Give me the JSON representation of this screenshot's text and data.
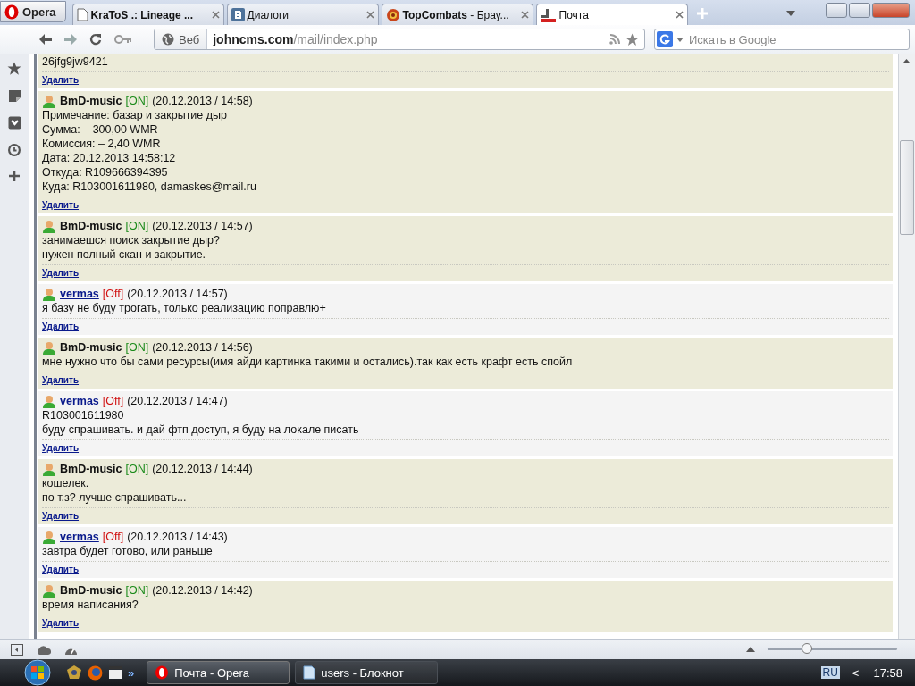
{
  "browser": {
    "menu_button": "Opera",
    "tabs": [
      {
        "label": "KraToS .: Lineage ...",
        "bold": true,
        "kind": "page",
        "selected": false
      },
      {
        "label": "Диалоги",
        "bold": false,
        "kind": "vk",
        "selected": false
      },
      {
        "label": "**TopCombats** - Брау...",
        "bold": false,
        "kind": "emblem",
        "selected": false
      },
      {
        "label": "Почта",
        "bold": false,
        "kind": "cms",
        "selected": true
      }
    ],
    "address": {
      "scope": "Веб",
      "host": "johncms.com",
      "path": "/mail/index.php"
    },
    "search": {
      "placeholder": "Искать в Google"
    }
  },
  "messages": [
    {
      "partial": true,
      "online": true,
      "lines": [
        "26jfg9jw9421"
      ],
      "delete": "Удалить"
    },
    {
      "partial": false,
      "author": "BmD-music",
      "online": true,
      "status": "[ON]",
      "time": "(20.12.2013 / 14:58)",
      "lines": [
        "Примечание: базар и закрытие дыр",
        "Сумма: – 300,00 WMR",
        "Комиссия: – 2,40 WMR",
        "Дата: 20.12.2013 14:58:12",
        "Откуда: R109666394395",
        "Куда: R103001611980, damaskes@mail.ru"
      ],
      "delete": "Удалить"
    },
    {
      "partial": false,
      "author": "BmD-music",
      "online": true,
      "status": "[ON]",
      "time": "(20.12.2013 / 14:57)",
      "lines": [
        "занимаешся поиск закрытие дыр?",
        "нужен полный скан и закрытие."
      ],
      "delete": "Удалить"
    },
    {
      "partial": false,
      "author": "vermas",
      "online": false,
      "status": "[Off]",
      "time": "(20.12.2013 / 14:57)",
      "lines": [
        "я базу не буду трогать, только реализацию поправлю+"
      ],
      "delete": "Удалить"
    },
    {
      "partial": false,
      "author": "BmD-music",
      "online": true,
      "status": "[ON]",
      "time": "(20.12.2013 / 14:56)",
      "lines": [
        "мне нужно что бы сами ресурсы(имя айди картинка такими и остались).так как есть крафт есть спойл"
      ],
      "delete": "Удалить"
    },
    {
      "partial": false,
      "author": "vermas",
      "online": false,
      "status": "[Off]",
      "time": "(20.12.2013 / 14:47)",
      "lines": [
        "R103001611980",
        "буду спрашивать. и дай фтп доступ, я буду на локале писать"
      ],
      "delete": "Удалить"
    },
    {
      "partial": false,
      "author": "BmD-music",
      "online": true,
      "status": "[ON]",
      "time": "(20.12.2013 / 14:44)",
      "lines": [
        "кошелек.",
        "по т.з? лучше спрашивать..."
      ],
      "delete": "Удалить"
    },
    {
      "partial": false,
      "author": "vermas",
      "online": false,
      "status": "[Off]",
      "time": "(20.12.2013 / 14:43)",
      "lines": [
        "завтра будет готово, или раньше"
      ],
      "delete": "Удалить"
    },
    {
      "partial": false,
      "author": "BmD-music",
      "online": true,
      "status": "[ON]",
      "time": "(20.12.2013 / 14:42)",
      "lines": [
        "время написания?"
      ],
      "delete": "Удалить"
    }
  ],
  "status_bar": {
    "zoom": {
      "level": 0.3
    }
  },
  "taskbar": {
    "overflow": "»",
    "tasks": [
      {
        "label": "Почта - Opera",
        "kind": "opera",
        "selected": true
      },
      {
        "label": "users - Блокнот",
        "kind": "notepad",
        "selected": false
      }
    ],
    "language": "RU",
    "tray_toggle": "<",
    "clock": "17:58"
  }
}
